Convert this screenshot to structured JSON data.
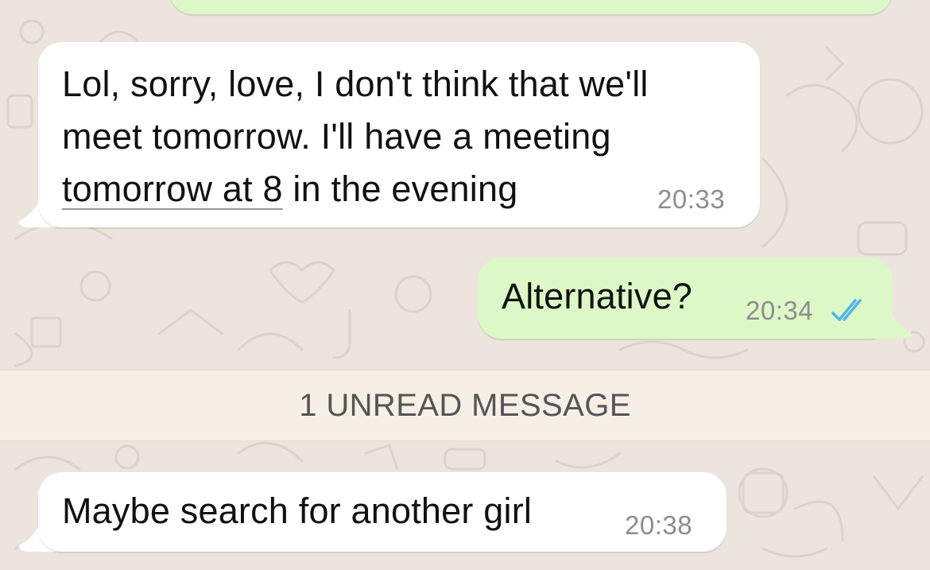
{
  "colors": {
    "wallpaper": "#ece5dd",
    "incoming_bubble": "#ffffff",
    "outgoing_bubble": "#dcf8c6",
    "read_ticks": "#4fb6ec",
    "timestamp": "#8d8d8d",
    "unread_banner": "#f6efe6"
  },
  "messages": [
    {
      "direction": "incoming",
      "lines": [
        "Lol, sorry, love, I don't think that we'll",
        "meet tomorrow. I'll have a meeting"
      ],
      "linked_text": "tomorrow at 8",
      "trailing_text": " in the evening",
      "time": "20:33"
    },
    {
      "direction": "outgoing",
      "text": "Alternative?",
      "time": "20:34",
      "status_icon": "double-check-read-icon"
    },
    {
      "direction": "incoming",
      "text": "Maybe search for another girl",
      "time": "20:38"
    }
  ],
  "unread_banner": {
    "text": "1 UNREAD MESSAGE"
  }
}
